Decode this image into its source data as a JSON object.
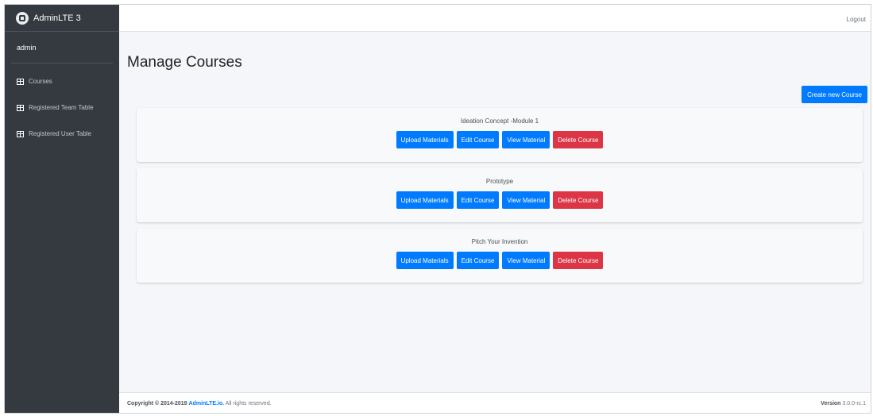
{
  "brand": {
    "name": "AdminLTE 3"
  },
  "user": {
    "name": "admin"
  },
  "sidebar": {
    "items": [
      {
        "label": "Courses",
        "icon": "table-icon"
      },
      {
        "label": "Registered Team Table",
        "icon": "table-icon"
      },
      {
        "label": "Registered User Table",
        "icon": "table-icon"
      }
    ]
  },
  "navbar": {
    "logout_label": "Logout"
  },
  "page": {
    "title": "Manage Courses",
    "create_label": "Create new Course"
  },
  "courses": [
    {
      "title": "Ideation Concept -Module 1",
      "upload_label": "Upload Materials",
      "edit_label": "Edit Course",
      "view_label": "View Material",
      "delete_label": "Delete Course"
    },
    {
      "title": "Prototype",
      "upload_label": "Upload Materials",
      "edit_label": "Edit Course",
      "view_label": "View Material",
      "delete_label": "Delete Course"
    },
    {
      "title": "Pitch Your Invention",
      "upload_label": "Upload Materials",
      "edit_label": "Edit Course",
      "view_label": "View Material",
      "delete_label": "Delete Course"
    }
  ],
  "footer": {
    "copyright_prefix": "Copyright © 2014-2019",
    "link_text": "AdminLTE.io.",
    "suffix": "All rights reserved.",
    "version_label": "Version",
    "version_value": "3.0.0-rc.1"
  },
  "colors": {
    "primary": "#007bff",
    "danger": "#dc3545",
    "sidebar_bg": "#343a40",
    "content_bg": "#f4f6f9"
  }
}
